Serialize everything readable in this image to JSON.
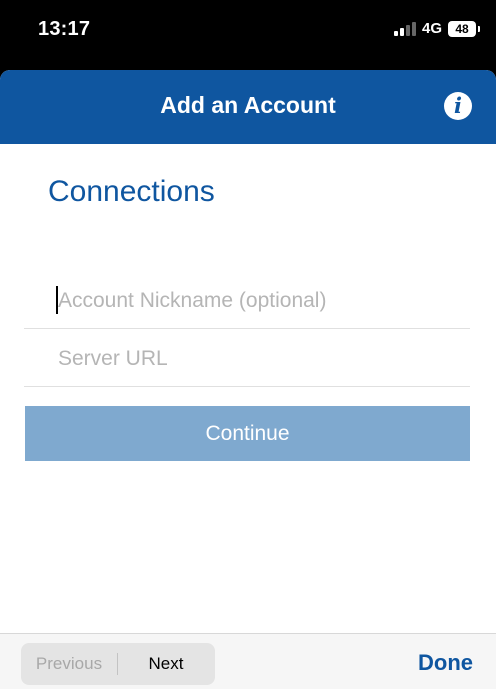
{
  "status_bar": {
    "time": "13:17",
    "network": "4G",
    "battery": "48"
  },
  "header": {
    "title": "Add an Account",
    "info_icon_glyph": "i",
    "bg_color": "#0f56a0"
  },
  "form": {
    "section_title": "Connections",
    "nickname_placeholder": "Account Nickname (optional)",
    "nickname_value": "",
    "server_placeholder": "Server URL",
    "server_value": "",
    "continue_label": "Continue",
    "continue_color": "#7fa9cf"
  },
  "keyboard_toolbar": {
    "previous_label": "Previous",
    "next_label": "Next",
    "done_label": "Done"
  },
  "icons": [
    "signal-icon",
    "battery-icon",
    "info-icon"
  ]
}
